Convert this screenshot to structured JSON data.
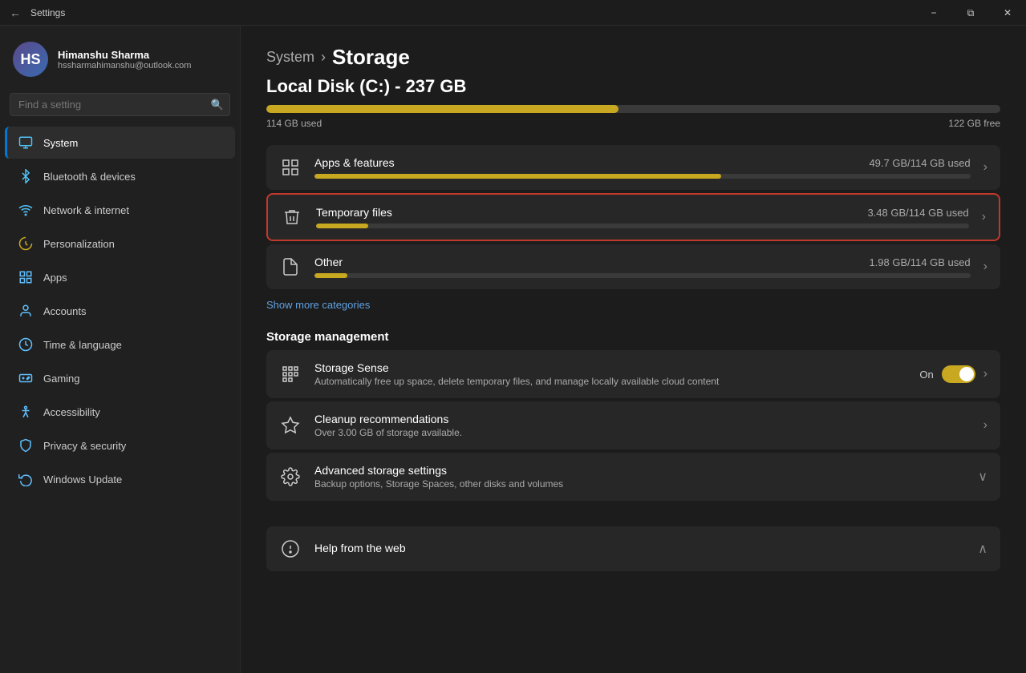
{
  "window": {
    "title": "Settings",
    "minimize_label": "−",
    "restore_label": "⧉",
    "close_label": "✕"
  },
  "sidebar": {
    "user": {
      "name": "Himanshu Sharma",
      "email": "hssharmahimanshu@outlook.com",
      "initials": "HS"
    },
    "search": {
      "placeholder": "Find a setting"
    },
    "nav_items": [
      {
        "id": "system",
        "label": "System",
        "active": true
      },
      {
        "id": "bluetooth",
        "label": "Bluetooth & devices",
        "active": false
      },
      {
        "id": "network",
        "label": "Network & internet",
        "active": false
      },
      {
        "id": "personalization",
        "label": "Personalization",
        "active": false
      },
      {
        "id": "apps",
        "label": "Apps",
        "active": false
      },
      {
        "id": "accounts",
        "label": "Accounts",
        "active": false
      },
      {
        "id": "time",
        "label": "Time & language",
        "active": false
      },
      {
        "id": "gaming",
        "label": "Gaming",
        "active": false
      },
      {
        "id": "accessibility",
        "label": "Accessibility",
        "active": false
      },
      {
        "id": "privacy",
        "label": "Privacy & security",
        "active": false
      },
      {
        "id": "windows-update",
        "label": "Windows Update",
        "active": false
      }
    ]
  },
  "breadcrumb": {
    "parent": "System",
    "separator": "›",
    "current": "Storage"
  },
  "disk": {
    "title": "Local Disk (C:) - 237 GB",
    "used_label": "114 GB used",
    "free_label": "122 GB free",
    "used_percent": 48
  },
  "storage_categories": [
    {
      "id": "apps-features",
      "label": "Apps & features",
      "size_label": "49.7 GB/114 GB used",
      "bar_percent": 62,
      "bar_color": "#c8a820",
      "highlighted": false
    },
    {
      "id": "temporary-files",
      "label": "Temporary files",
      "size_label": "3.48 GB/114 GB used",
      "bar_percent": 8,
      "bar_color": "#c8a820",
      "highlighted": true
    },
    {
      "id": "other",
      "label": "Other",
      "size_label": "1.98 GB/114 GB used",
      "bar_percent": 5,
      "bar_color": "#c8a820",
      "highlighted": false
    }
  ],
  "show_more": "Show more categories",
  "storage_management": {
    "section_title": "Storage management",
    "items": [
      {
        "id": "storage-sense",
        "label": "Storage Sense",
        "desc": "Automatically free up space, delete temporary files, and manage locally available cloud content",
        "toggle": true,
        "toggle_label": "On",
        "has_chevron": true
      },
      {
        "id": "cleanup-recommendations",
        "label": "Cleanup recommendations",
        "desc": "Over 3.00 GB of storage available.",
        "toggle": false,
        "has_chevron": true
      },
      {
        "id": "advanced-storage-settings",
        "label": "Advanced storage settings",
        "desc": "Backup options, Storage Spaces, other disks and volumes",
        "toggle": false,
        "has_chevron": true,
        "chevron_down": true
      }
    ]
  },
  "help": {
    "label": "Help from the web",
    "chevron_up": true
  }
}
